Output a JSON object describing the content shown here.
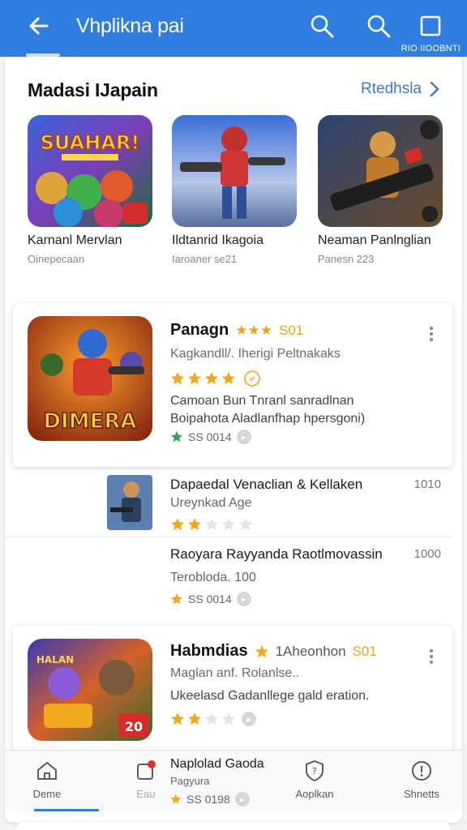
{
  "appbar": {
    "title": "Vhplikna pai",
    "subtitle": "RIO IIOOBNTI",
    "accent": "#2f7ee0"
  },
  "section": {
    "title": "Madasi IJapain",
    "link": "Rtedhsla"
  },
  "featured": [
    {
      "name": "Karnanl Mervlan",
      "meta": "Oinepecaan",
      "art_text": "SUAHAR!"
    },
    {
      "name": "Ildtanrid Ikagoia",
      "meta": "Iaroaner se21",
      "art_text": ""
    },
    {
      "name": "Neaman Panlnglian",
      "meta": "Panesn 223",
      "art_text": ""
    }
  ],
  "card1": {
    "title": "Panagn",
    "stars_label": "★★★",
    "number": "S01",
    "subtitle": "Kagkandll/. Iherigi Peltnakaks",
    "rating": 4,
    "desc_line1": "Camoan Bun Tnranl sanradlnan",
    "desc_line2": "Boipahota Aladlanfhap hpersgoni)",
    "footer": "SS 0014",
    "art_text": "DIMERA"
  },
  "rows": [
    {
      "title": "Dapaedal Venaclian & Kellaken",
      "num": "1010",
      "sub": "Ureynkad Age",
      "rating": 2
    },
    {
      "title": "Raoyara Rayyanda Raotlmovassin",
      "num": "1000",
      "sub": "Terobloda. 100",
      "footer": "SS 0014"
    }
  ],
  "card2": {
    "title": "Habmdias",
    "tag": "1Aheonhon",
    "number": "S01",
    "subtitle": "Maglan anf. Rolanlse..",
    "desc": "Ukeelasd Gadanllege gald eration.",
    "rating": 2,
    "badge": "20",
    "art_text": "HALAN"
  },
  "bottomnav": {
    "items": [
      "Deme",
      "Eau",
      "Aoplkan",
      "Shnetts"
    ],
    "overlay_title": "Naplolad Gaoda",
    "overlay_sub": "Pagyura",
    "overlay_footer": "SS 0198"
  }
}
